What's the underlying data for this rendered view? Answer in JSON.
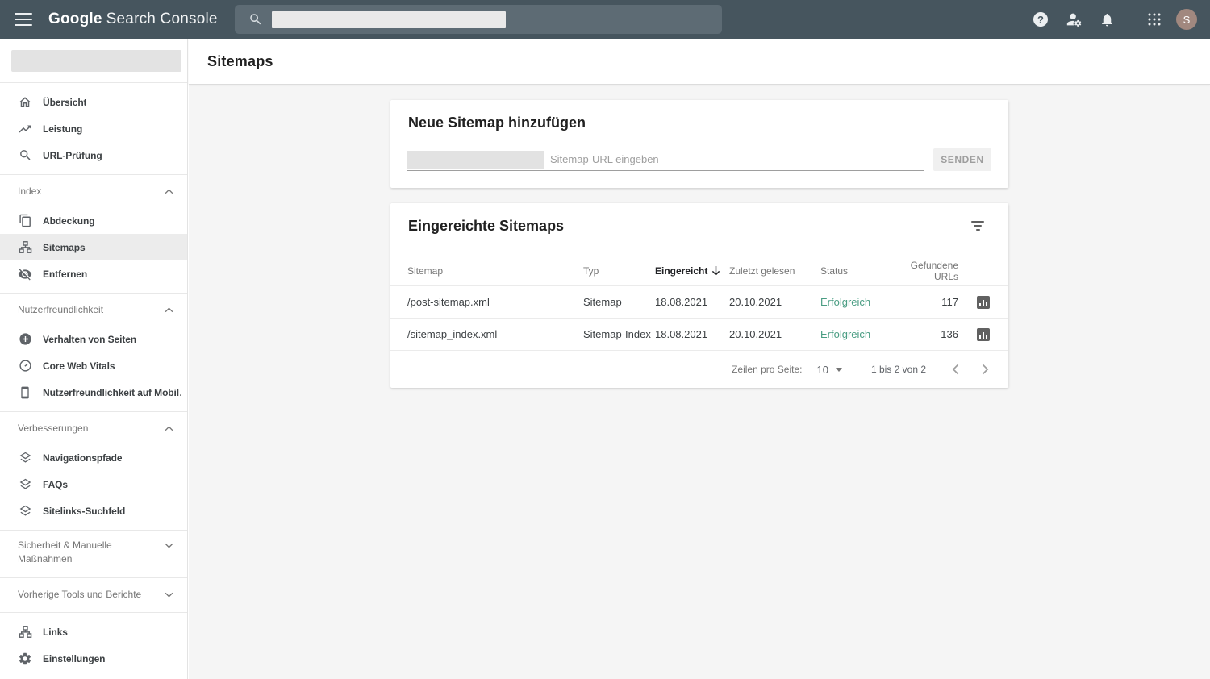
{
  "topbar": {
    "logo_bold": "Google",
    "logo_product": "Search Console",
    "help_glyph": "?",
    "avatar_letter": "S"
  },
  "page": {
    "title": "Sitemaps"
  },
  "sidebar": {
    "items": {
      "uebersicht": "Übersicht",
      "leistung": "Leistung",
      "url_pruefung": "URL-Prüfung",
      "abdeckung": "Abdeckung",
      "sitemaps": "Sitemaps",
      "entfernen": "Entfernen",
      "verhalten": "Verhalten von Seiten",
      "core_web_vitals": "Core Web Vitals",
      "mobil": "Nutzerfreundlichkeit auf Mobil…",
      "navigationspfade": "Navigationspfade",
      "faqs": "FAQs",
      "sitelinks": "Sitelinks-Suchfeld",
      "links": "Links",
      "einstellungen": "Einstellungen"
    },
    "sections": {
      "index": "Index",
      "nutzerfreundlichkeit": "Nutzerfreundlichkeit",
      "verbesserungen": "Verbesserungen",
      "sicherheit": "Sicherheit & Manuelle Maßnahmen",
      "vorherige": "Vorherige Tools und Berichte"
    }
  },
  "add_card": {
    "title": "Neue Sitemap hinzufügen",
    "placeholder": "Sitemap-URL eingeben",
    "submit_label": "SENDEN"
  },
  "table_card": {
    "title": "Eingereichte Sitemaps",
    "columns": [
      "Sitemap",
      "Typ",
      "Eingereicht",
      "Zuletzt gelesen",
      "Status",
      "Gefundene URLs"
    ],
    "rows": [
      {
        "sitemap": "/post-sitemap.xml",
        "typ": "Sitemap",
        "eingereicht": "18.08.2021",
        "zuletzt_gelesen": "20.10.2021",
        "status": "Erfolgreich",
        "gefundene_urls": "117"
      },
      {
        "sitemap": "/sitemap_index.xml",
        "typ": "Sitemap-Index",
        "eingereicht": "18.08.2021",
        "zuletzt_gelesen": "20.10.2021",
        "status": "Erfolgreich",
        "gefundene_urls": "136"
      }
    ],
    "pagination": {
      "rows_per_page_label": "Zeilen pro Seite:",
      "rows_per_page_value": "10",
      "range_label": "1 bis 2 von 2"
    }
  },
  "colors": {
    "topbar_bg": "#46555e",
    "status_success_green": "#4a9d83",
    "selected_nav_bg": "#ececec",
    "content_bg": "#f5f5f5",
    "avatar_bg": "#a1887f"
  }
}
